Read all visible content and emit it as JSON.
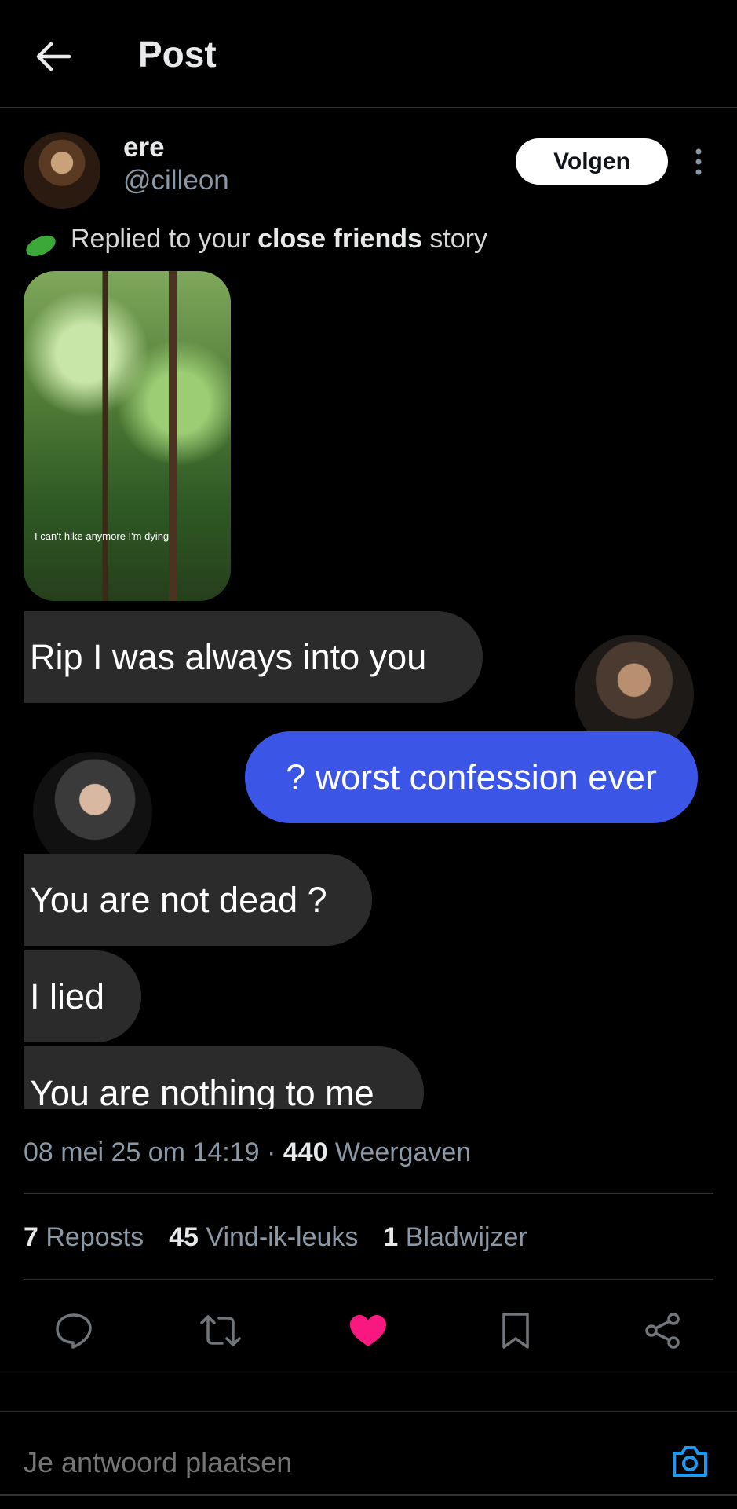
{
  "header": {
    "title": "Post"
  },
  "author": {
    "name": "ere",
    "handle": "@cilleon",
    "follow_label": "Volgen"
  },
  "embedded": {
    "story_ref_prefix": "Replied to your ",
    "story_ref_bold": "close friends",
    "story_ref_suffix": " story",
    "story_caption": "I can't hike anymore I'm dying",
    "messages": [
      {
        "text": "Rip I was always into you",
        "side": "left"
      },
      {
        "text": "? worst confession ever",
        "side": "right"
      },
      {
        "text": "You are not dead ?",
        "side": "left"
      },
      {
        "text": "I lied",
        "side": "left"
      },
      {
        "text": "You are nothing to me",
        "side": "left"
      }
    ]
  },
  "meta": {
    "timestamp": "08 mei 25 om 14:19 · ",
    "views_count": "440",
    "views_label": " Weergaven"
  },
  "stats": {
    "reposts_count": "7",
    "reposts_label": "Reposts",
    "likes_count": "45",
    "likes_label": "Vind-ik-leuks",
    "bookmarks_count": "1",
    "bookmarks_label": "Bladwijzer"
  },
  "actions": {
    "like_color": "#f91880",
    "icons": [
      "reply-icon",
      "repost-icon",
      "like-icon",
      "bookmark-icon",
      "share-icon"
    ]
  },
  "reply": {
    "placeholder": "Je antwoord plaatsen"
  },
  "colors": {
    "background": "#000000",
    "accent": "#1d9bf0",
    "bubble_blue": "#3b55e6",
    "bubble_gray": "#2b2b2b"
  }
}
